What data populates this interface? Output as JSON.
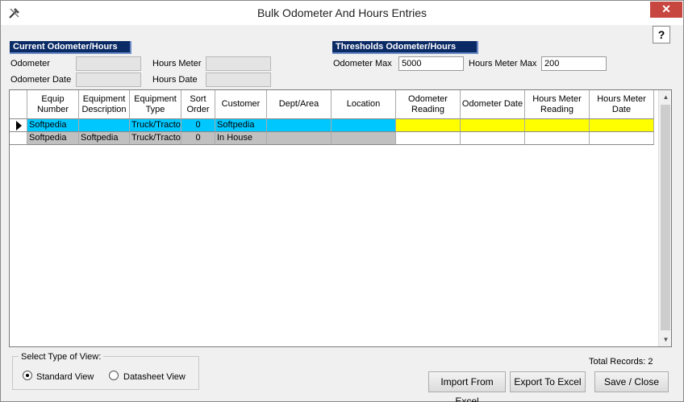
{
  "window": {
    "title": "Bulk Odometer And Hours Entries",
    "close_label": "✕",
    "help_label": "?"
  },
  "current": {
    "header": "Current Odometer/Hours",
    "odometer_label": "Odometer",
    "odometer_value": "",
    "hours_meter_label": "Hours Meter",
    "hours_meter_value": "",
    "odometer_date_label": "Odometer Date",
    "odometer_date_value": "",
    "hours_date_label": "Hours Date",
    "hours_date_value": ""
  },
  "thresholds": {
    "header": "Thresholds Odometer/Hours",
    "odometer_max_label": "Odometer Max",
    "odometer_max_value": "5000",
    "hours_meter_max_label": "Hours Meter Max",
    "hours_meter_max_value": "200"
  },
  "grid": {
    "columns": [
      "Equip Number",
      "Equipment Description",
      "Equipment Type",
      "Sort Order",
      "Customer",
      "Dept/Area",
      "Location",
      "Odometer Reading",
      "Odometer Date",
      "Hours Meter Reading",
      "Hours Meter Date"
    ],
    "rows": [
      [
        "Softpedia",
        "",
        "Truck/Tracto",
        "0",
        "Softpedia",
        "",
        "",
        "",
        "",
        "",
        ""
      ],
      [
        "Softpedia",
        "Softpedia",
        "Truck/Tracto",
        "0",
        "In House",
        "",
        "",
        "",
        "",
        "",
        ""
      ]
    ]
  },
  "view": {
    "title": "Select Type of View:",
    "standard_label": "Standard View",
    "datasheet_label": "Datasheet View",
    "selected": "Standard View"
  },
  "total_records": "Total Records: 2",
  "buttons": {
    "import": "Import From Excel",
    "export": "Export To Excel",
    "save_close": "Save / Close"
  },
  "icons": {
    "app": "tools-icon",
    "row_pointer": "triangle-right-icon",
    "scroll_up": "chevron-up-icon",
    "scroll_down": "chevron-down-icon"
  }
}
